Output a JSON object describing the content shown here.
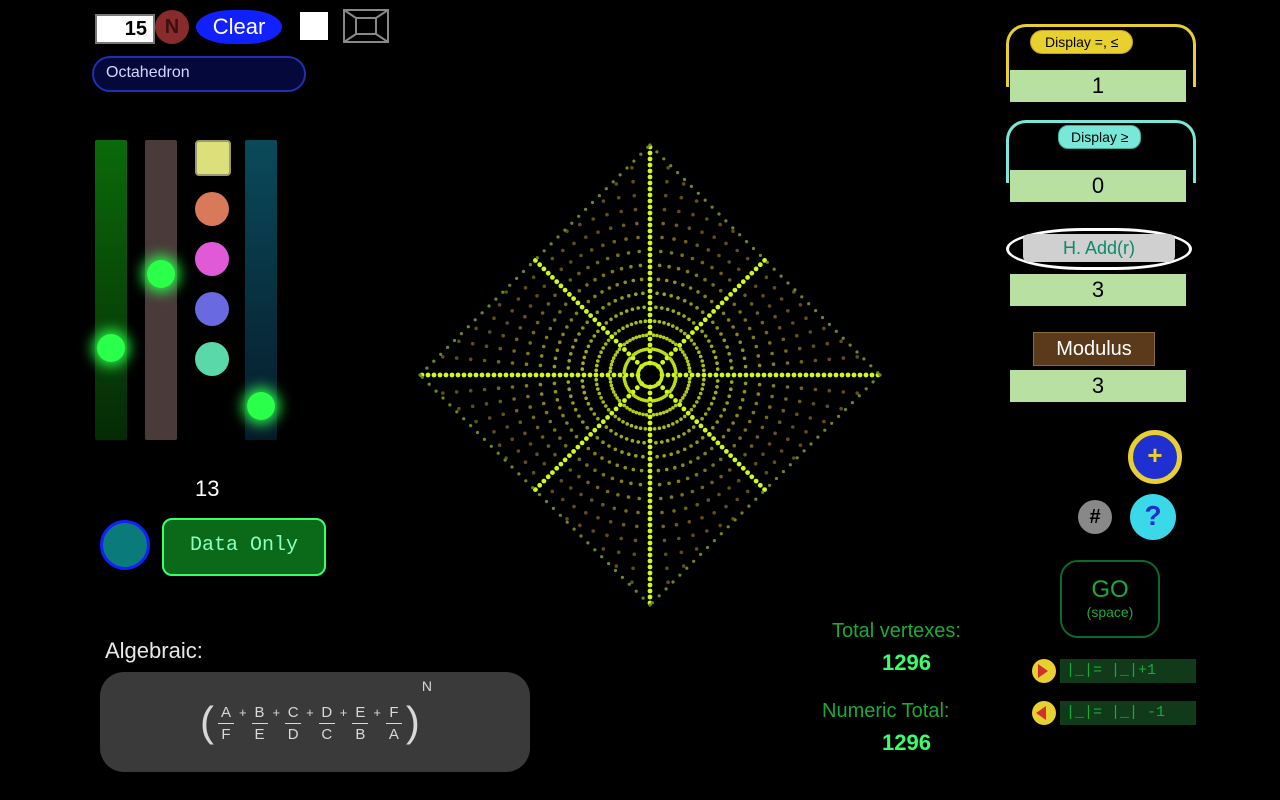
{
  "top": {
    "size_value": "15",
    "n_label": "N",
    "clear_label": "Clear",
    "shape_selected": "Octahedron"
  },
  "sliders": {
    "value_display": "13"
  },
  "data_only_label": "Data Only",
  "right": {
    "tab_display_le": "Display =, ≤",
    "tab_display_ge": "Display ≥",
    "val_le": "1",
    "val_ge": "0",
    "hadd_label": "H. Add(r)",
    "hadd_val": "3",
    "modulus_label": "Modulus",
    "modulus_val": "3",
    "plus_label": "+",
    "hash_label": "#",
    "help_label": "?",
    "go_line1": "GO",
    "go_line2": "(space)",
    "step_inc": "|_|= |_|+1",
    "step_dec": "|_|= |_| -1"
  },
  "stats": {
    "total_vertexes_label": "Total vertexes:",
    "total_vertexes": "1296",
    "numeric_total_label": "Numeric Total:",
    "numeric_total": "1296"
  },
  "algebraic": {
    "label": "Algebraic:",
    "numerators": [
      "A",
      "B",
      "C",
      "D",
      "E",
      "F"
    ],
    "denominators": [
      "F",
      "E",
      "D",
      "C",
      "B",
      "A"
    ],
    "exponent": "N"
  }
}
